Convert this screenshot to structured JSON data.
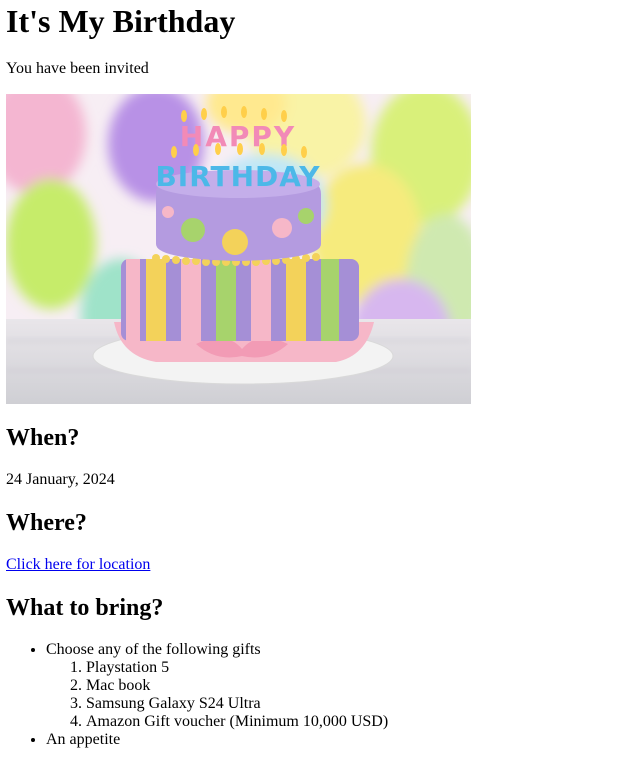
{
  "page": {
    "title": "It's My Birthday",
    "subtitle": "You have been invited"
  },
  "image": {
    "alt": "Birthday cake with candles spelling HAPPY BIRTHDAY in front of colorful balloons",
    "candle_text_top": "HAPPY",
    "candle_text_bottom": "BIRTHDAY"
  },
  "when": {
    "heading": "When?",
    "date": "24 January, 2024"
  },
  "where": {
    "heading": "Where?",
    "link_text": "Click here for location"
  },
  "bring": {
    "heading": "What to bring?",
    "items": [
      {
        "label": "Choose any of the following gifts",
        "gifts": [
          "Playstation 5",
          "Mac book",
          "Samsung Galaxy S24 Ultra",
          "Amazon Gift voucher (Minimum 10,000 USD)"
        ]
      },
      {
        "label": "An appetite"
      }
    ]
  },
  "colors": {
    "link": "#0000ee",
    "cake_purple": "#a58fd6",
    "cake_pink": "#f6b7c8",
    "cake_yellow": "#f3d25a",
    "cake_green": "#a7d36c"
  }
}
